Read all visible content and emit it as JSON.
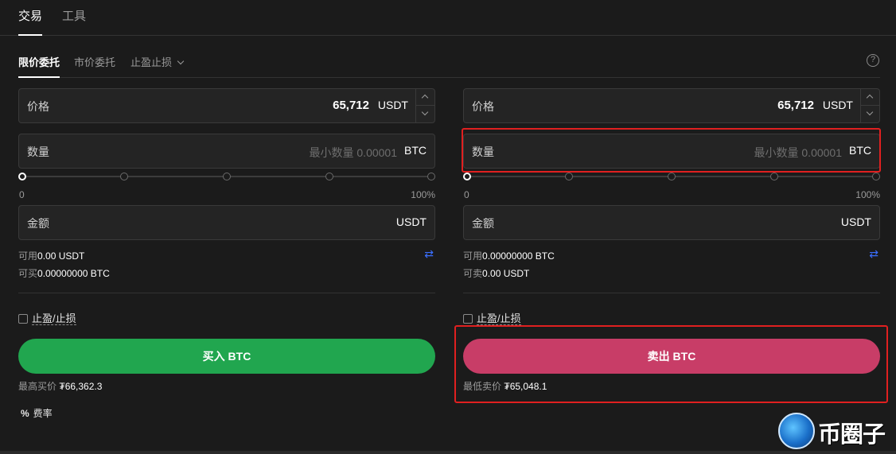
{
  "top_tabs": [
    {
      "label": "交易",
      "active": true
    },
    {
      "label": "工具",
      "active": false
    }
  ],
  "order_tabs": [
    {
      "label": "限价委托",
      "active": true
    },
    {
      "label": "市价委托",
      "active": false
    },
    {
      "label": "止盈止损",
      "active": false
    }
  ],
  "help_icon": "?",
  "buy": {
    "price_label": "价格",
    "price_value": "65,712",
    "price_unit": "USDT",
    "qty_label": "数量",
    "qty_placeholder": "最小数量 0.00001",
    "qty_unit": "BTC",
    "slider_min": "0",
    "slider_max": "100%",
    "slider_percent": 0,
    "amount_label": "金额",
    "amount_unit": "USDT",
    "available_label": "可用",
    "available_value": "0.00 USDT",
    "can_trade_label": "可买",
    "can_trade_value": "0.00000000 BTC",
    "tpsl_label": "止盈/止损",
    "button_label": "买入 BTC",
    "best_price_label": "最高买价",
    "best_price_value": "₮66,362.3"
  },
  "sell": {
    "price_label": "价格",
    "price_value": "65,712",
    "price_unit": "USDT",
    "qty_label": "数量",
    "qty_placeholder": "最小数量 0.00001",
    "qty_unit": "BTC",
    "slider_min": "0",
    "slider_max": "100%",
    "slider_percent": 0,
    "amount_label": "金额",
    "amount_unit": "USDT",
    "available_label": "可用",
    "available_value": "0.00000000 BTC",
    "can_trade_label": "可卖",
    "can_trade_value": "0.00 USDT",
    "tpsl_label": "止盈/止损",
    "button_label": "卖出 BTC",
    "best_price_label": "最低卖价",
    "best_price_value": "₮65,048.1"
  },
  "fee": {
    "icon": "%",
    "label": "费率"
  },
  "watermark": {
    "text": "币圈子"
  },
  "colors": {
    "buy": "#21a64f",
    "sell": "#c83d67",
    "highlight": "#e02020",
    "swap": "#3b6fff"
  }
}
